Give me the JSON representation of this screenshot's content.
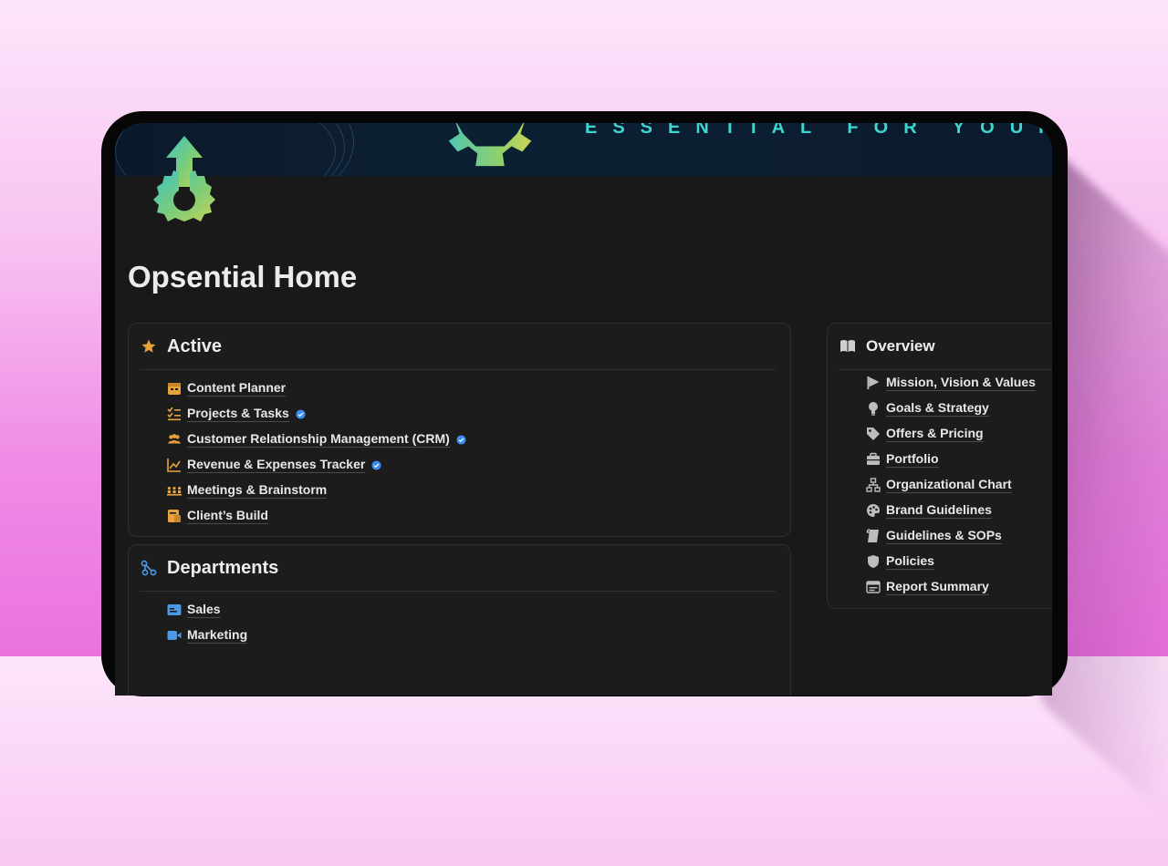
{
  "cover": {
    "tagline": "ESSENTIAL FOR YOUR OPE"
  },
  "page": {
    "title": "Opsential Home"
  },
  "active": {
    "heading": "Active",
    "items": [
      {
        "label": "Content Planner",
        "icon": "calendar-icon",
        "verified": false
      },
      {
        "label": "Projects & Tasks",
        "icon": "checklist-icon",
        "verified": true
      },
      {
        "label": "Customer Relationship Management (CRM)",
        "icon": "people-icon",
        "verified": true
      },
      {
        "label": "Revenue & Expenses Tracker",
        "icon": "chart-icon",
        "verified": true
      },
      {
        "label": "Meetings & Brainstorm",
        "icon": "meeting-icon",
        "verified": false
      },
      {
        "label": "Client’s Build",
        "icon": "build-icon",
        "verified": false
      }
    ]
  },
  "departments": {
    "heading": "Departments",
    "items": [
      {
        "label": "Sales",
        "icon": "card-icon"
      },
      {
        "label": "Marketing",
        "icon": "video-icon"
      }
    ]
  },
  "overview": {
    "heading": "Overview",
    "items": [
      {
        "label": "Mission, Vision & Values",
        "icon": "flag-icon"
      },
      {
        "label": "Goals & Strategy",
        "icon": "lightbulb-icon"
      },
      {
        "label": "Offers & Pricing",
        "icon": "tag-icon"
      },
      {
        "label": "Portfolio",
        "icon": "briefcase-icon"
      },
      {
        "label": "Organizational Chart",
        "icon": "org-chart-icon"
      },
      {
        "label": "Brand Guidelines",
        "icon": "palette-icon"
      },
      {
        "label": "Guidelines & SOPs",
        "icon": "scroll-icon"
      },
      {
        "label": "Policies",
        "icon": "shield-icon"
      },
      {
        "label": "Report Summary",
        "icon": "report-icon"
      }
    ]
  },
  "colors": {
    "accent_orange": "#e7a33a",
    "accent_blue": "#4a9ae8",
    "icon_gray": "#bdbdbd",
    "verified_blue": "#3b8ef0"
  }
}
